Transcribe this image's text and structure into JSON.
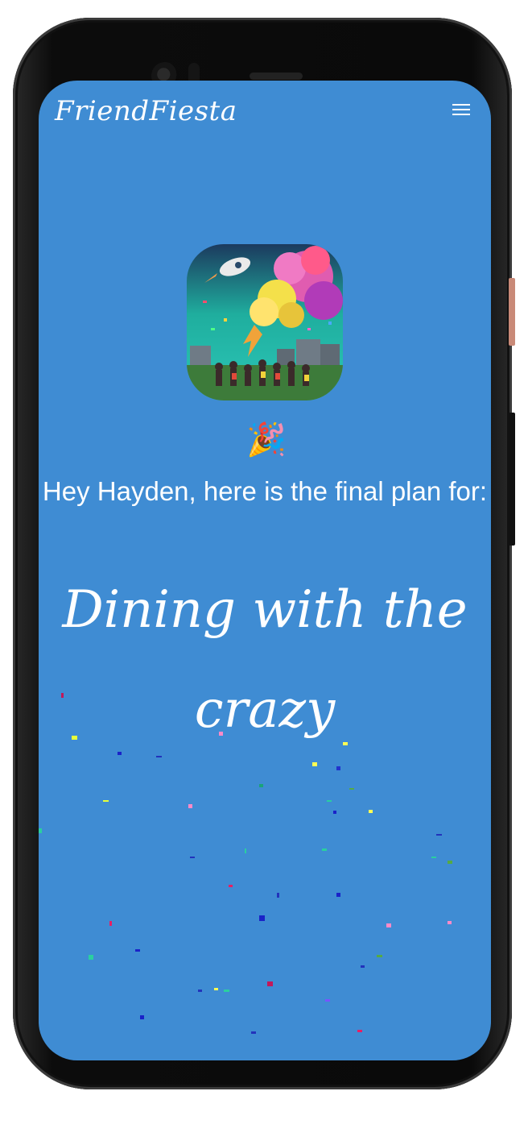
{
  "app": {
    "brand": "FriendFiesta",
    "menu_icon": "hamburger-menu-icon"
  },
  "hero": {
    "image_description": "party-celebration-art",
    "party_icon": "🎉"
  },
  "message": {
    "greeting": "Hey Hayden, here is the final plan for:",
    "event_title": "Dining with the crazy"
  },
  "colors": {
    "screen_background": "#3f8cd3",
    "text": "#ffffff"
  }
}
